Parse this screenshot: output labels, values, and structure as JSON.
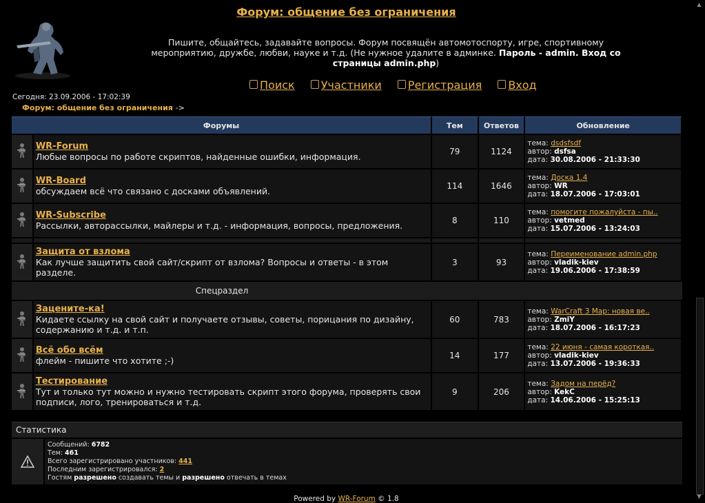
{
  "forum_title": "Форум: общение без ограничения",
  "desc_text": "Пишите, общайтесь, задавайте вопросы. Форум посвящён автомотоспорту, игре, спортивному мероприятию, дружбе, любви, науке и т.д. (Не нужное удалите в админке.",
  "desc_bold": "Пароль - admin. Вход со страницы admin.php",
  "desc_tail": ")",
  "nav": {
    "search": "Поиск",
    "members": "Участники",
    "register": "Регистрация",
    "login": "Вход"
  },
  "today": "Сегодня: 23.09.2006 - 17:02:39",
  "breadcrumb": "Форум: общение без ограничения",
  "breadcrumb_arrow": "->",
  "headers": {
    "forums": "Форумы",
    "topics": "Тем",
    "replies": "Ответов",
    "updated": "Обновление"
  },
  "labels": {
    "topic": "тема:",
    "author": "автор:",
    "date": "дата:"
  },
  "forums": [
    {
      "name": "WR-Forum",
      "desc": "Любые вопросы по работе скриптов, найденные ошибки, информация.",
      "topics": "79",
      "replies": "1124",
      "last_topic": "dsdsfsdf",
      "author": "dsfsa",
      "date": "30.08.2006 - 21:33:30"
    },
    {
      "name": "WR-Board",
      "desc": "обсуждаем всё что связано с досками объявлений.",
      "topics": "114",
      "replies": "1646",
      "last_topic": "Доска 1.4",
      "author": "WR",
      "date": "18.07.2006 - 17:03:01"
    },
    {
      "name": "WR-Subscribe",
      "desc": "Рассылки, авторассылки, майлеры и т.д. - информация, вопросы, предложения.",
      "topics": "8",
      "replies": "110",
      "last_topic": "помогите пожалуйста - пы..",
      "author": "vetmed",
      "date": "15.07.2006 - 13:24:03"
    },
    {
      "name": "Защита от взлома",
      "desc": "Как лучше защитить свой сайт/скрипт от взлома? Вопросы и ответы - в этом разделе.",
      "topics": "3",
      "replies": "93",
      "last_topic": "Переименование admin.php",
      "author": "vladik-kiev",
      "date": "19.06.2006 - 17:38:59"
    },
    {
      "name": "Зацените-ка!",
      "desc": "Кидаете ссылку на свой сайт и получаете отзывы, советы, порицания по дизайну, содержанию и т.д. и т.п.",
      "topics": "60",
      "replies": "783",
      "last_topic": "WarCraft 3 Map: новая ве..",
      "author": "ZmiY",
      "date": "18.07.2006 - 16:17:23"
    },
    {
      "name": "Всё обо всём",
      "desc": "флейм - пишите что хотите ;-)",
      "topics": "14",
      "replies": "177",
      "last_topic": "22 июня - самая короткая..",
      "author": "vladik-kiev",
      "date": "13.07.2006 - 19:36:33"
    },
    {
      "name": "Тестирование",
      "desc": "Тут и только тут можно и нужно тестировать скрипт этого форума, проверять свои подписи, лого, тренироваться и т.д.",
      "topics": "9",
      "replies": "206",
      "last_topic": "Задом на перёд?",
      "author": "KekC",
      "date": "14.06.2006 - 15:25:13"
    }
  ],
  "category_special": "Спецраздел",
  "stats": {
    "title": "Статистика",
    "messages_label": "Сообщений:",
    "messages_value": "6782",
    "topics_label": "Тем:",
    "topics_value": "461",
    "members_label": "Всего зарегистрировано участников:",
    "members_value": "441",
    "last_reg_label": "Последним зарегистрировался:",
    "last_reg_value": "2",
    "guests_1": "Гостям",
    "guests_2": "разрешено",
    "guests_3": "создавать темы и",
    "guests_4": "разрешено",
    "guests_5": "отвечать в темах"
  },
  "footer": {
    "powered": "Powered by",
    "link": "WR-Forum",
    "version": "© 1.8"
  },
  "colors": {
    "background": "#000000",
    "header_bg": "#243a5c",
    "link": "#e8b14a",
    "cell_bg": "#141414"
  }
}
